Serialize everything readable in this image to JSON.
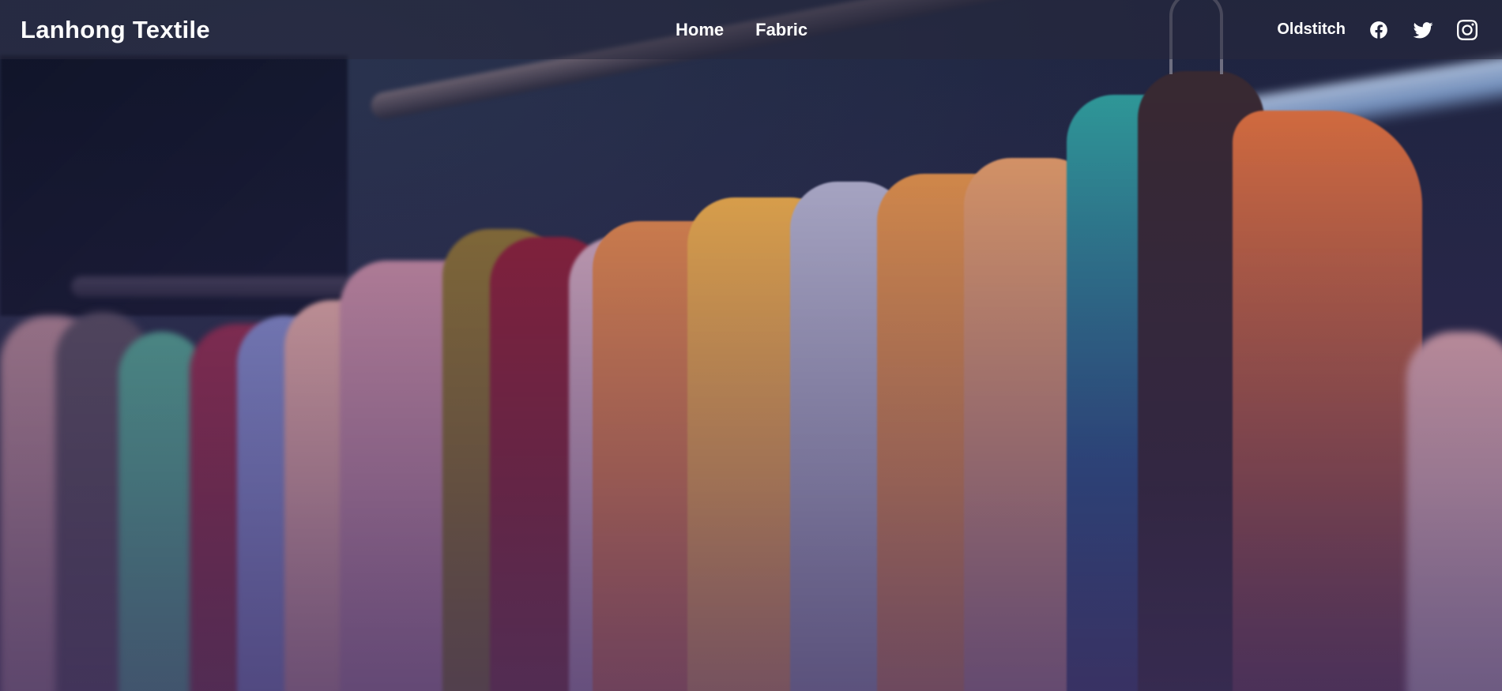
{
  "brand": {
    "name": "Lanhong Textile"
  },
  "nav": {
    "links": [
      {
        "label": "Home"
      },
      {
        "label": "Fabric"
      }
    ]
  },
  "right_nav": {
    "label": "Oldstitch",
    "social_icons": [
      "facebook-icon",
      "twitter-icon",
      "instagram-icon"
    ]
  },
  "hero": {
    "image_subject": "garments-on-rack",
    "overlay_color": "#2d2747"
  },
  "colors": {
    "text": "#ffffff",
    "navbar_bg": "#28283c"
  }
}
